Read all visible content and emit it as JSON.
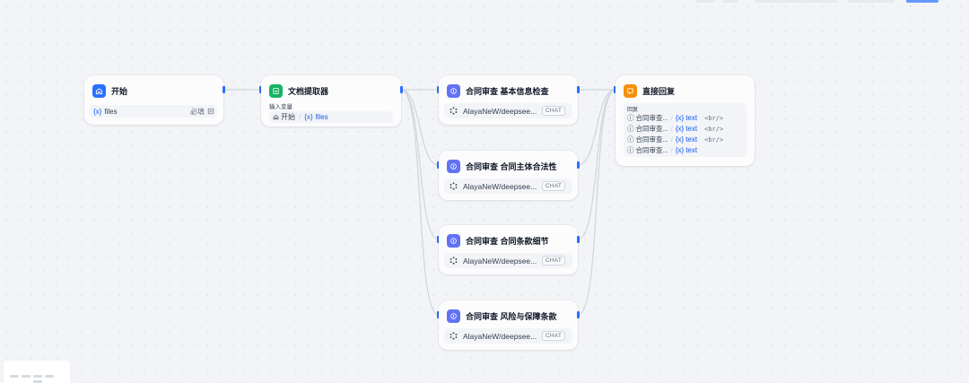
{
  "colors": {
    "accent": "#2970ff",
    "start_icon": "#2970ff",
    "extractor_icon": "#16b364",
    "llm_icon": "#6172f3",
    "answer_icon": "#f79009",
    "edge": "#d0d5dc",
    "canvas_bg": "#f2f4f7"
  },
  "start_node": {
    "title": "开始",
    "icon": "home-icon",
    "var_prefix": "{x}",
    "var_name": "files",
    "required_label": "必填",
    "file_icon": "file-icon"
  },
  "extractor_node": {
    "title": "文档提取器",
    "icon": "doc-extract-icon",
    "input_label": "输入变量",
    "source_node": "开始",
    "var_prefix": "{x}",
    "var_name": "files"
  },
  "llm_nodes": [
    {
      "title": "合同审查 基本信息检查",
      "icon": "llm-icon",
      "model": "AlayaNeW/deepsee...",
      "mode_badge": "CHAT"
    },
    {
      "title": "合同审查 合同主体合法性",
      "icon": "llm-icon",
      "model": "AlayaNeW/deepsee...",
      "mode_badge": "CHAT"
    },
    {
      "title": "合同审查 合同条款细节",
      "icon": "llm-icon",
      "model": "AlayaNeW/deepsee...",
      "mode_badge": "CHAT"
    },
    {
      "title": "合同审查 风险与保障条款",
      "icon": "llm-icon",
      "model": "AlayaNeW/deepsee...",
      "mode_badge": "CHAT"
    }
  ],
  "answer_node": {
    "title": "直接回复",
    "icon": "answer-icon",
    "answer_label": "回复",
    "lines": [
      {
        "node": "合同审查...",
        "var_prefix": "{x}",
        "var": "text",
        "suffix": "<br/>"
      },
      {
        "node": "合同审查...",
        "var_prefix": "{x}",
        "var": "text",
        "suffix": "<br/>"
      },
      {
        "node": "合同审查...",
        "var_prefix": "{x}",
        "var": "text",
        "suffix": "<br/>"
      },
      {
        "node": "合同审查...",
        "var_prefix": "{x}",
        "var": "text",
        "suffix": ""
      }
    ]
  }
}
